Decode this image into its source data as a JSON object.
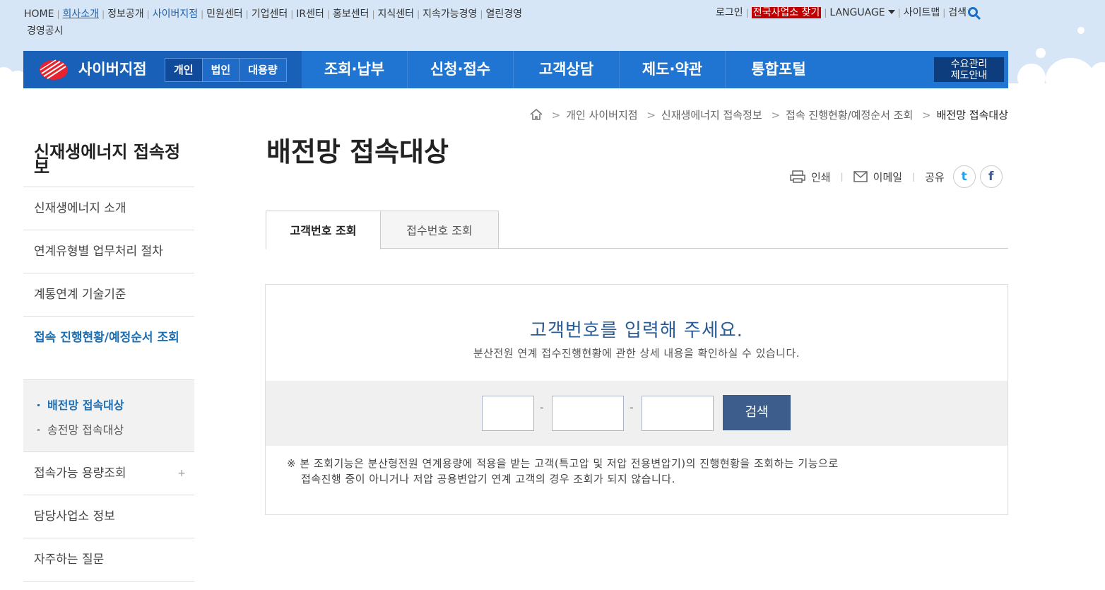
{
  "util_left": [
    "HOME",
    "회사소개",
    "정보공개",
    "사이버지점",
    "민원센터",
    "기업센터",
    "IR센터",
    "홍보센터",
    "지식센터",
    "지속가능경영",
    "열린경영",
    "경영공시"
  ],
  "util_right": {
    "login": "로그인",
    "find_office": "전국사업소 찾기",
    "language": "LANGUAGE",
    "sitemap": "사이트맵",
    "search": "검색"
  },
  "gnb": {
    "brand": "사이버지점",
    "segments": [
      "개인",
      "법인",
      "대용량"
    ],
    "menu": [
      "조회·납부",
      "신청·접수",
      "고객상담",
      "제도·약관",
      "통합포털"
    ],
    "demand_line1": "수요관리",
    "demand_line2": "제도안내"
  },
  "breadcrumb": [
    "개인 사이버지점",
    "신재생에너지 접속정보",
    "접속 진행현황/예정순서 조회",
    "배전망 접속대상"
  ],
  "lnb": {
    "title": "신재생에너지 접속정보",
    "items": [
      "신재생에너지 소개",
      "연계유형별 업무처리 절차",
      "계통연계 기술기준",
      "접속 진행현황/예정순서 조회"
    ],
    "sub": [
      "배전망 접속대상",
      "송전망 접속대상"
    ],
    "items2": [
      "접속가능 용량조회",
      "담당사업소 정보",
      "자주하는 질문"
    ],
    "plus": "+"
  },
  "page_title": "배전망 접속대상",
  "share": {
    "print": "인쇄",
    "email": "이메일",
    "share": "공유",
    "twitter": "t",
    "facebook": "f"
  },
  "tabs": [
    "고객번호 조회",
    "접수번호 조회"
  ],
  "form": {
    "heading": "고객번호를 입력해 주세요.",
    "desc": "분산전원 연계 접수진행현황에 관한 상세 내용을 확인하실 수 있습니다.",
    "dash": "-",
    "search_btn": "검색",
    "note_line1": "※ 본 조회기능은 분산형전원 연계용량에 적용을 받는 고객(특고압 및 저압 전용변압기)의 진행현황을 조회하는 기능으로",
    "note_line2": "접속진행 중이 아니거나 저압 공용변압기 연계 고객의 경우 조회가 되지 않습니다."
  },
  "colors": {
    "brand_blue": "#1f75d1",
    "dark_blue": "#1960b8",
    "button": "#3d5e8c",
    "highlight_red": "#c00000",
    "active_text": "#1a6fb6"
  }
}
